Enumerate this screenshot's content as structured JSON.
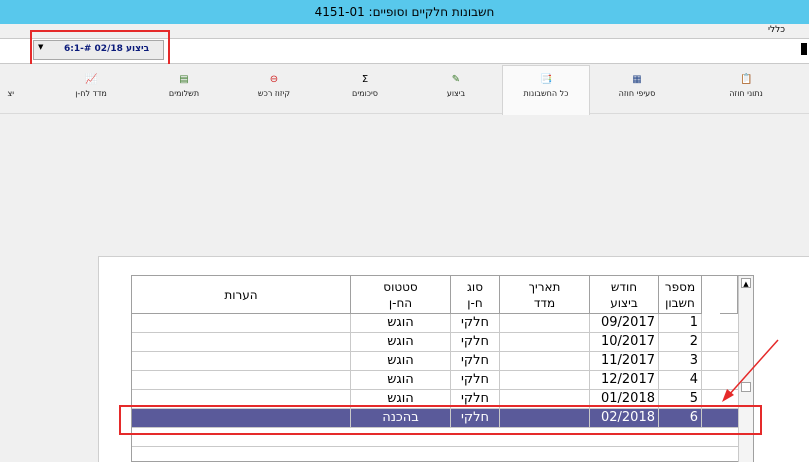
{
  "window": {
    "title": "חשבונות חלקיים וסופיים: 4151-01"
  },
  "menubar": {
    "items": [
      "כללי"
    ]
  },
  "combo": {
    "value": "6:1-# ביצוע 02/18",
    "arrow": "▼"
  },
  "toolbar": {
    "items": [
      {
        "label": "נתוני חוזה",
        "icon": "📋"
      },
      {
        "label": "סעיפי חוזה",
        "icon": "▦"
      },
      {
        "label": "כל החשבונות",
        "icon": "📑"
      },
      {
        "label": "ביצוע",
        "icon": "✎"
      },
      {
        "label": "סיכומים",
        "icon": "Σ"
      },
      {
        "label": "קיזוז רכש",
        "icon": "⊖"
      },
      {
        "label": "תשלומים",
        "icon": "▤"
      },
      {
        "label": "מדד לח-ן",
        "icon": "📈"
      },
      {
        "label": "יצ",
        "icon": "➜"
      }
    ]
  },
  "table": {
    "headers": [
      "מספר\nחשבון",
      "חודש\nביצוע",
      "תאריך\nמדד",
      "סוג\nח-ן",
      "סטטוס\nהח-ן",
      "הערות"
    ],
    "rows": [
      {
        "num": "1",
        "month": "09/2017",
        "date": "",
        "type": "חלקי",
        "status": "הוגש",
        "notes": ""
      },
      {
        "num": "2",
        "month": "10/2017",
        "date": "",
        "type": "חלקי",
        "status": "הוגש",
        "notes": ""
      },
      {
        "num": "3",
        "month": "11/2017",
        "date": "",
        "type": "חלקי",
        "status": "הוגש",
        "notes": ""
      },
      {
        "num": "4",
        "month": "12/2017",
        "date": "",
        "type": "חלקי",
        "status": "הוגש",
        "notes": ""
      },
      {
        "num": "5",
        "month": "01/2018",
        "date": "",
        "type": "חלקי",
        "status": "הוגש",
        "notes": ""
      },
      {
        "num": "6",
        "month": "02/2018",
        "date": "",
        "type": "חלקי",
        "status": "בהכנה",
        "notes": ""
      }
    ],
    "selected_row": 6
  },
  "scrollbar": {
    "up_icon": "▲"
  },
  "colors": {
    "titlebar": "#58c8ec",
    "selection": "#5a5a9a",
    "highlight": "#e52a2a"
  }
}
